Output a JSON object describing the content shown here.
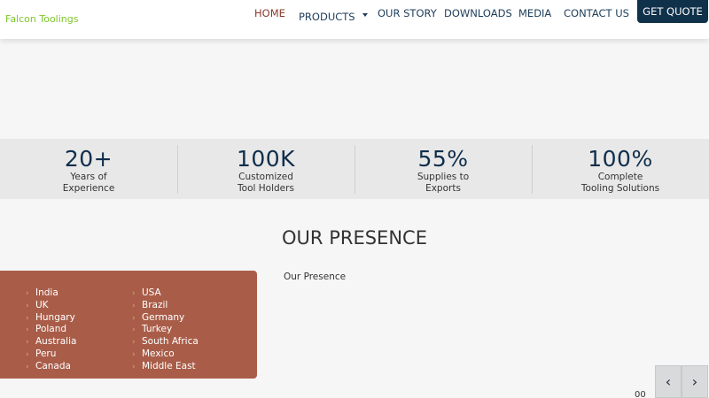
{
  "header": {
    "logo_text": "Falcon Toolings",
    "nav": {
      "home": "HOME",
      "products": "PRODUCTS",
      "our_story": "OUR STORY",
      "downloads": "DOWNLOADS",
      "media": "MEDIA",
      "contact_us": "CONTACT US"
    },
    "quote_button": "GET QUOTE",
    "active_item": "HOME"
  },
  "stats": [
    {
      "number": "20+",
      "line1": "Years of",
      "line2": "Experience"
    },
    {
      "number": "100K",
      "line1": "Customized",
      "line2": "Tool Holders"
    },
    {
      "number": "55%",
      "line1": "Supplies to",
      "line2": "Exports"
    },
    {
      "number": "100%",
      "line1": "Complete",
      "line2": "Tooling Solutions"
    }
  ],
  "presence": {
    "title": "OUR PRESENCE",
    "countries_left": [
      "India",
      "UK",
      "Hungary",
      "Poland",
      "Australia",
      "Peru",
      "Canada"
    ],
    "countries_right": [
      "USA",
      "Brazil",
      "Germany",
      "Turkey",
      "South Africa",
      "Mexico",
      "Middle East"
    ],
    "map_caption": "Our Presence"
  },
  "slider": {
    "prev_icon": "‹",
    "next_icon": "›",
    "page_text": "00"
  },
  "colors": {
    "accent_green": "#7ec62b",
    "navy": "#10314a",
    "country_box": "#a95d48",
    "active_nav": "#8a3b2a"
  }
}
